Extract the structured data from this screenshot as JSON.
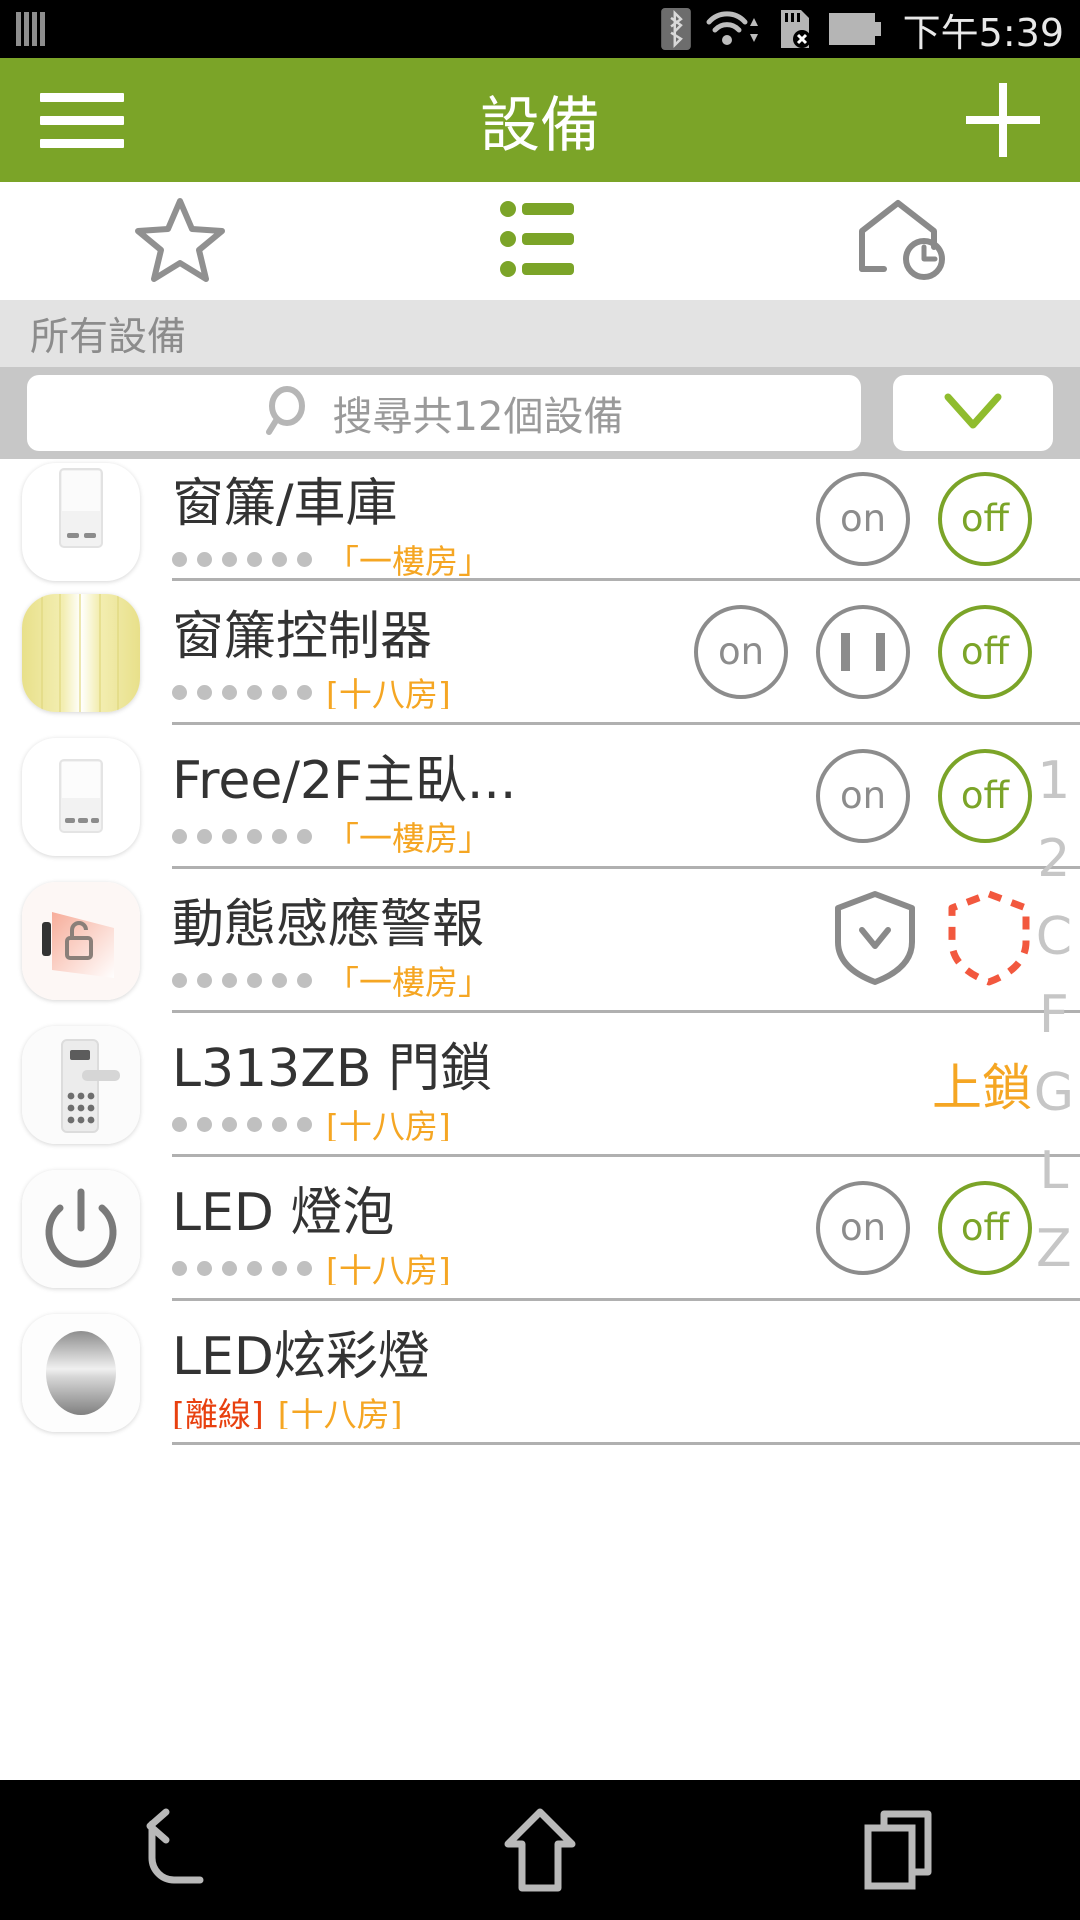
{
  "status_bar": {
    "time": "下午5:39",
    "icons": [
      "sim-signal-icon",
      "bluetooth-icon",
      "wifi-icon",
      "sdcard-error-icon",
      "battery-icon"
    ]
  },
  "app_bar": {
    "menu_icon": "hamburger-menu-icon",
    "title": "設備",
    "add_icon": "plus-icon",
    "bg_color": "#7ba428"
  },
  "tabs": [
    {
      "name": "favorites",
      "icon": "star-icon",
      "selected": false
    },
    {
      "name": "all-devices",
      "icon": "list-icon",
      "selected": true
    },
    {
      "name": "schedule",
      "icon": "home-clock-icon",
      "selected": false
    }
  ],
  "section": {
    "label": "所有設備"
  },
  "search": {
    "placeholder": "搜尋共12個設備",
    "icon": "search-icon",
    "dropdown_icon": "chevron-down-icon"
  },
  "index_scroller": [
    "1",
    "2",
    "C",
    "F",
    "G",
    "L",
    "Z"
  ],
  "devices": [
    {
      "name": "窗簾/車庫",
      "room": "「一樓房」",
      "offline": "",
      "icon": "curtain-switch-icon",
      "controls": [
        {
          "type": "toggle",
          "label": "on",
          "active": false
        },
        {
          "type": "toggle",
          "label": "off",
          "active": true
        }
      ]
    },
    {
      "name": "窗簾控制器",
      "room": "[十八房]",
      "offline": "",
      "icon": "curtain-icon",
      "controls": [
        {
          "type": "toggle",
          "label": "on",
          "active": false
        },
        {
          "type": "pause",
          "label": "",
          "active": false
        },
        {
          "type": "toggle",
          "label": "off",
          "active": true
        }
      ]
    },
    {
      "name": "Free/2F主臥...",
      "room": "「一樓房」",
      "offline": "",
      "icon": "wall-switch-icon",
      "controls": [
        {
          "type": "toggle",
          "label": "on",
          "active": false
        },
        {
          "type": "toggle",
          "label": "off",
          "active": true
        }
      ]
    },
    {
      "name": "動態感應警報",
      "room": "「一樓房」",
      "offline": "",
      "icon": "door-sensor-icon",
      "controls": [
        {
          "type": "shield",
          "label": "",
          "active": false
        },
        {
          "type": "shield-alert",
          "label": "",
          "active": true
        }
      ]
    },
    {
      "name": "L313ZB 門鎖",
      "room": "[十八房]",
      "offline": "",
      "icon": "door-lock-icon",
      "controls": [
        {
          "type": "text",
          "label": "上鎖",
          "active": true
        }
      ]
    },
    {
      "name": "LED 燈泡",
      "room": "[十八房]",
      "offline": "",
      "icon": "power-icon",
      "controls": [
        {
          "type": "toggle",
          "label": "on",
          "active": false
        },
        {
          "type": "toggle",
          "label": "off",
          "active": true
        }
      ]
    },
    {
      "name": "LED炫彩燈",
      "room": "[十八房]",
      "offline": "[離線]",
      "icon": "rgb-bulb-icon",
      "controls": []
    }
  ],
  "nav_bar": {
    "back_icon": "back-arrow-icon",
    "home_icon": "home-icon",
    "recents_icon": "recents-icon"
  }
}
